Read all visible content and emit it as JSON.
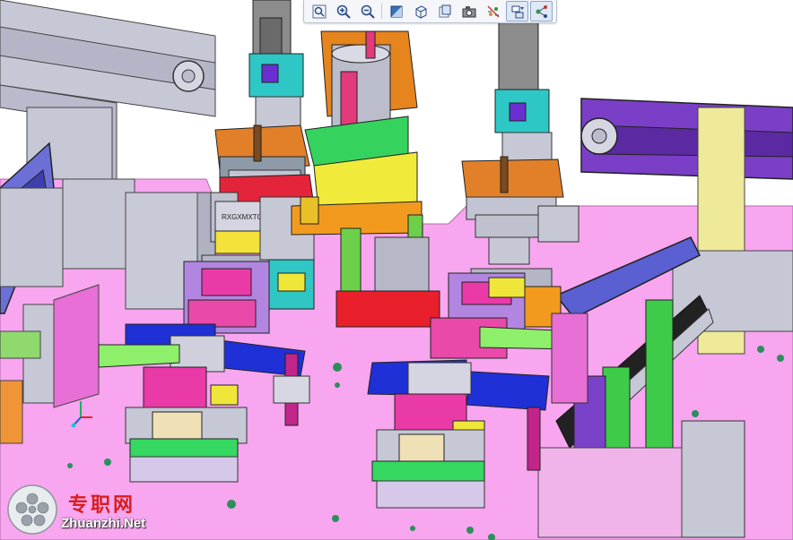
{
  "toolbar": {
    "buttons": [
      {
        "name": "zoom-fit-button",
        "icon": "zoom-fit-icon"
      },
      {
        "name": "zoom-in-button",
        "icon": "zoom-in-icon"
      },
      {
        "name": "zoom-out-button",
        "icon": "zoom-out-icon"
      },
      {
        "name": "shading-button",
        "icon": "shading-icon"
      },
      {
        "name": "view-orientation-button",
        "icon": "cube-icon"
      },
      {
        "name": "section-view-button",
        "icon": "section-view-icon"
      },
      {
        "name": "capture-button",
        "icon": "camera-icon"
      },
      {
        "name": "show-hide-button",
        "icon": "show-hide-icon"
      },
      {
        "name": "display-style-button",
        "icon": "display-style-icon"
      },
      {
        "name": "relations-button",
        "icon": "relations-icon"
      }
    ]
  },
  "model": {
    "label_text": "RXGXMXTGH",
    "triad_axes": [
      "y-axis",
      "z-axis",
      "x-axis"
    ],
    "colors": {
      "floor": "#f7a6ef",
      "frame_gray": "#c7c8d6",
      "purple": "#7a3fc6",
      "blue": "#1a2fd9",
      "green": "#49d84a",
      "magenta": "#e83aa6",
      "red": "#e8242c",
      "orange": "#e27a1e",
      "cyan": "#2fc4c4",
      "yellow": "#f2ee4a",
      "lime": "#8ef06a"
    }
  },
  "watermark": {
    "cn": "专职网",
    "en": "Zhuanzhi.Net"
  }
}
